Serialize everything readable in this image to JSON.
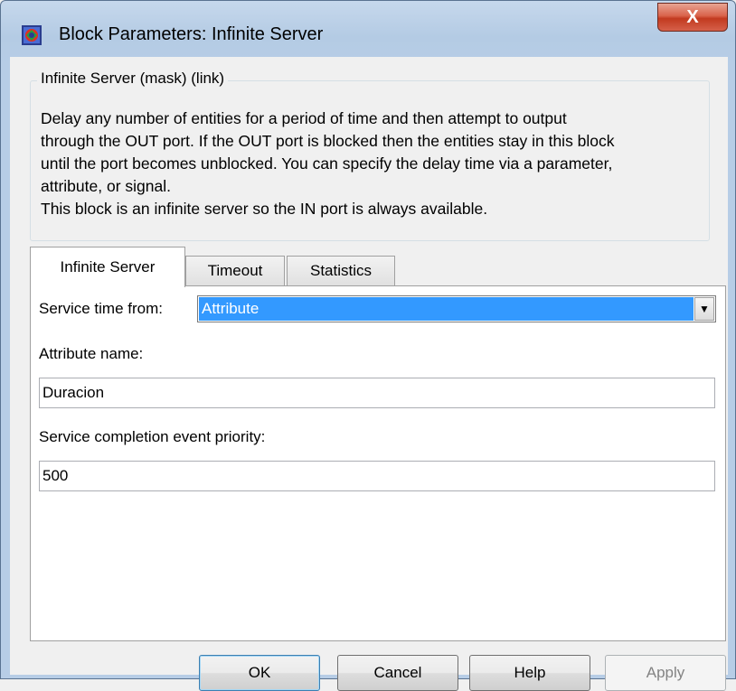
{
  "window": {
    "title": "Block Parameters: Infinite Server",
    "close_label": "X"
  },
  "group": {
    "title": "Infinite Server (mask) (link)",
    "description_lines": [
      "Delay any number of entities for a period of time and then attempt to output",
      "through the OUT port. If the OUT port is blocked then the entities stay in this block",
      "until the port becomes unblocked. You can specify the delay time via a parameter,",
      "attribute, or signal.",
      "This block is an infinite server so the IN port is always available."
    ]
  },
  "tabs": [
    {
      "label": "Infinite Server",
      "active": true
    },
    {
      "label": "Timeout",
      "active": false
    },
    {
      "label": "Statistics",
      "active": false
    }
  ],
  "form": {
    "service_time_label": "Service time from:",
    "service_time_value": "Attribute",
    "attribute_name_label": "Attribute name:",
    "attribute_name_value": "Duracion",
    "priority_label": "Service completion event priority:",
    "priority_value": "500"
  },
  "buttons": {
    "ok": "OK",
    "cancel": "Cancel",
    "help": "Help",
    "apply": "Apply"
  },
  "icons": {
    "app": "simulink-block-icon",
    "dropdown": "chevron-down-icon"
  },
  "colors": {
    "selection": "#3399ff",
    "close_button": "#c23a1f"
  }
}
